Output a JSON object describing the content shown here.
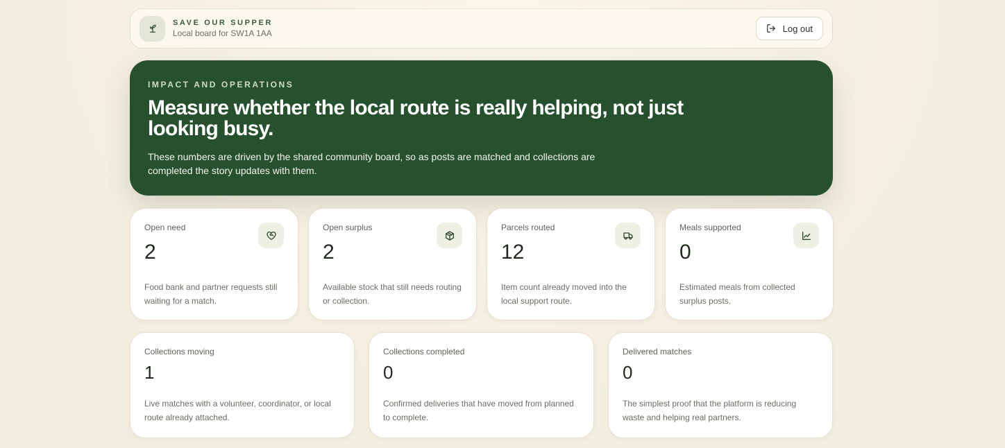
{
  "header": {
    "brand_title": "SAVE OUR SUPPER",
    "brand_subtitle": "Local board for SW1A 1AA",
    "brand_icon": "sprout-icon",
    "logout_label": "Log out",
    "logout_icon": "log-out-icon"
  },
  "hero": {
    "eyebrow": "IMPACT AND OPERATIONS",
    "title": "Measure whether the local route is really helping, not just looking busy.",
    "body": "These numbers are driven by the shared community board, so as posts are matched and collections are completed the story updates with them."
  },
  "stats_primary": [
    {
      "label": "Open need",
      "value": "2",
      "description": "Food bank and partner requests still waiting for a match.",
      "icon": "heart-handshake-icon"
    },
    {
      "label": "Open surplus",
      "value": "2",
      "description": "Available stock that still needs routing or collection.",
      "icon": "package-icon"
    },
    {
      "label": "Parcels routed",
      "value": "12",
      "description": "Item count already moved into the local support route.",
      "icon": "truck-icon"
    },
    {
      "label": "Meals supported",
      "value": "0",
      "description": "Estimated meals from collected surplus posts.",
      "icon": "line-chart-icon"
    }
  ],
  "stats_secondary": [
    {
      "label": "Collections moving",
      "value": "1",
      "description": "Live matches with a volunteer, coordinator, or local route already attached."
    },
    {
      "label": "Collections completed",
      "value": "0",
      "description": "Confirmed deliveries that have moved from planned to complete."
    },
    {
      "label": "Delivered matches",
      "value": "0",
      "description": "The simplest proof that the platform is reducing waste and helping real partners."
    }
  ],
  "colors": {
    "hero_background": "#27502e",
    "accent": "#3b5a3b",
    "page_background": "#f4efe2"
  }
}
